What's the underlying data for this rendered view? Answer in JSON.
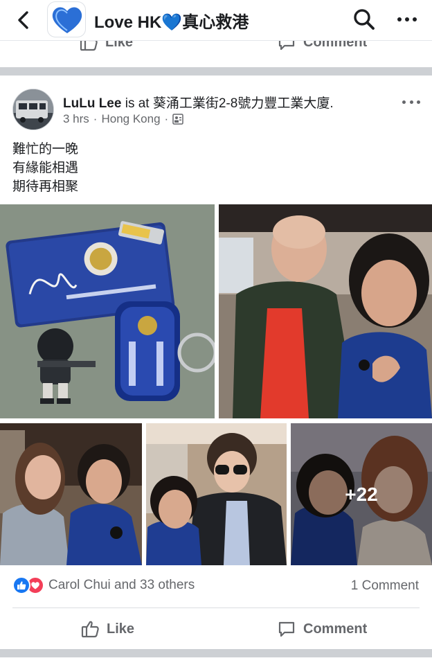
{
  "header": {
    "title": "Love HK💙真心救港",
    "back_icon": "chevron-left-icon",
    "search_icon": "search-icon",
    "more_icon": "more-horizontal-icon"
  },
  "previous_post": {
    "like_label": "Like",
    "comment_label": "Comment"
  },
  "post": {
    "author": "LuLu Lee",
    "author_suffix": " is at 葵涌工業街2-8號力豐工業大廈.",
    "time": "3 hrs",
    "location": "Hong Kong",
    "audience_icon": "public-audience-icon",
    "text_lines": [
      "難忙的一晚",
      "有緣能相遇",
      "期待再相聚"
    ],
    "photos_more_count": "+22",
    "reactions_text": "Carol Chui and 33 others",
    "comments_count": "1 Comment",
    "like_label": "Like",
    "comment_label": "Comment"
  },
  "colors": {
    "facebook_blue": "#1877f2",
    "love_red": "#f33e58",
    "separator": "#cdd0d4",
    "secondary_text": "#65676b"
  }
}
